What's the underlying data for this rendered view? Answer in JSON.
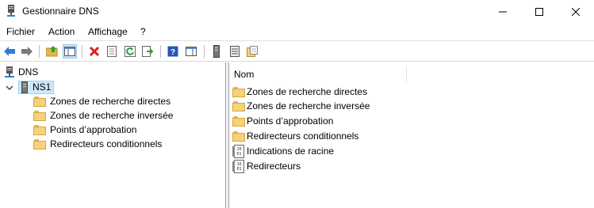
{
  "window": {
    "title": "Gestionnaire DNS"
  },
  "menu": {
    "items": [
      "Fichier",
      "Action",
      "Affichage",
      "?"
    ]
  },
  "tree": {
    "root": "DNS",
    "server": "NS1",
    "children": [
      "Zones de recherche directes",
      "Zones de recherche inversée",
      "Points d’approbation",
      "Redirecteurs conditionnels"
    ]
  },
  "list": {
    "column_header": "Nom",
    "items": [
      {
        "label": "Zones de recherche directes",
        "icon": "folder-icon"
      },
      {
        "label": "Zones de recherche inversée",
        "icon": "folder-icon"
      },
      {
        "label": "Points d’approbation",
        "icon": "folder-icon"
      },
      {
        "label": "Redirecteurs conditionnels",
        "icon": "folder-icon"
      },
      {
        "label": "Indications de racine",
        "icon": "root-hints-icon"
      },
      {
        "label": "Redirecteurs",
        "icon": "forwarders-icon"
      }
    ]
  },
  "colors": {
    "selection": "#cce8ff",
    "folder": "#f6d27a",
    "delete": "#d42020"
  }
}
